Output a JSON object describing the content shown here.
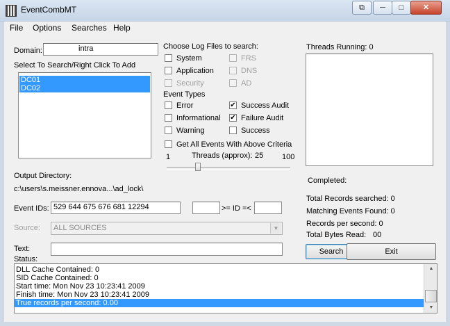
{
  "window": {
    "title": "EventCombMT",
    "minimize": "─",
    "maximize": "□",
    "close": "✕",
    "extra": "⧉"
  },
  "menu": [
    "File",
    "Options",
    "Searches",
    "Help"
  ],
  "domain": {
    "label": "Domain:",
    "value": "intra"
  },
  "servers": {
    "label": "Select To Search/Right Click To Add",
    "items": [
      "DC01",
      "DC02"
    ]
  },
  "log_files": {
    "label": "Choose Log Files to search:",
    "system": {
      "label": "System",
      "checked": false
    },
    "application": {
      "label": "Application",
      "checked": false
    },
    "security": {
      "label": "Security",
      "checked": false,
      "disabled": true
    },
    "frs": {
      "label": "FRS",
      "checked": false,
      "disabled": true
    },
    "dns": {
      "label": "DNS",
      "checked": false,
      "disabled": true
    },
    "ad": {
      "label": "AD",
      "checked": false,
      "disabled": true
    }
  },
  "event_types": {
    "label": "Event Types",
    "error": {
      "label": "Error",
      "checked": false
    },
    "informational": {
      "label": "Informational",
      "checked": false
    },
    "warning": {
      "label": "Warning",
      "checked": false
    },
    "success_audit": {
      "label": "Success Audit",
      "checked": true
    },
    "failure_audit": {
      "label": "Failure Audit",
      "checked": true
    },
    "success": {
      "label": "Success",
      "checked": false
    },
    "get_all": {
      "label": "Get All Events With Above Criteria",
      "checked": false
    }
  },
  "threads": {
    "min": "1",
    "max": "100",
    "label": "Threads (approx):",
    "value": "25",
    "slider_fraction": 0.25
  },
  "threads_running": {
    "label": "Threads Running: 0"
  },
  "output": {
    "label": "Output Directory:",
    "path": "c:\\users\\s.meissner.ennova...\\ad_lock\\"
  },
  "event_ids": {
    "label": "Event IDs:",
    "value": "529 644 675 676 681 12294",
    "range_value": "",
    "range_label": ">= ID =<",
    "range_end": ""
  },
  "source": {
    "label": "Source:",
    "value": "ALL SOURCES"
  },
  "text": {
    "label": "Text:",
    "value": ""
  },
  "status": {
    "label": "Status:",
    "lines": [
      "DLL Cache Contained: 0",
      "SID Cache Contained: 0",
      "Start time: Mon Nov 23 10:23:41 2009",
      "Finish time: Mon Nov 23 10:23:41 2009",
      "True records per second: 0.00"
    ],
    "selected_index": 4
  },
  "stats": {
    "completed": "Completed:",
    "total_records": "Total Records searched: 0",
    "matching": "Matching Events Found: 0",
    "per_second": "Records per second: 0",
    "bytes_label": "Total Bytes Read:",
    "bytes_value": "00"
  },
  "buttons": {
    "search": "Search",
    "exit": "Exit"
  }
}
